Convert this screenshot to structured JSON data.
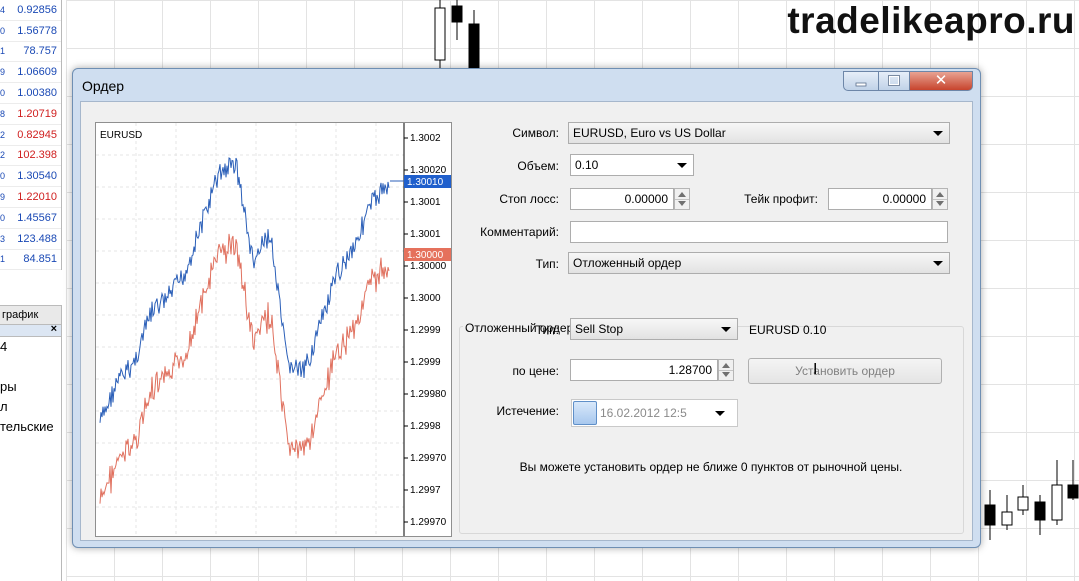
{
  "watermark": "tradelikeapro.ru",
  "quotes": [
    {
      "mark": "4",
      "value": "0.92856",
      "color": "up"
    },
    {
      "mark": "0",
      "value": "1.56778",
      "color": "up"
    },
    {
      "mark": "1",
      "value": "78.757",
      "color": "up"
    },
    {
      "mark": "9",
      "value": "1.06609",
      "color": "up"
    },
    {
      "mark": "0",
      "value": "1.00380",
      "color": "up"
    },
    {
      "mark": "8",
      "value": "1.20719",
      "color": "down"
    },
    {
      "mark": "2",
      "value": "0.82945",
      "color": "down"
    },
    {
      "mark": "2",
      "value": "102.398",
      "color": "down"
    },
    {
      "mark": "0",
      "value": "1.30540",
      "color": "up"
    },
    {
      "mark": "9",
      "value": "1.22010",
      "color": "down"
    },
    {
      "mark": "0",
      "value": "1.45567",
      "color": "up"
    },
    {
      "mark": "3",
      "value": "123.488",
      "color": "up"
    },
    {
      "mark": "1",
      "value": "84.851",
      "color": "up"
    }
  ],
  "left_panel": {
    "tab_label": "график",
    "nav_close": "×",
    "items": [
      "4",
      "",
      "ры",
      "л",
      "тельские"
    ]
  },
  "dialog": {
    "title": "Ордер",
    "close_glyph": "✕",
    "chart": {
      "symbol_label": "EURUSD",
      "y_ticks": [
        "1.3002",
        "1.30020",
        "1.3001",
        "1.3001",
        "1.30000",
        "1.3000",
        "1.2999",
        "1.2999",
        "1.29980",
        "1.2998",
        "1.29970",
        "1.2997",
        "1.29970"
      ],
      "ask_price": "1.30010",
      "bid_price": "1.30000"
    },
    "form": {
      "symbol_label": "Символ:",
      "symbol_value": "EURUSD, Euro vs US Dollar",
      "volume_label": "Объем:",
      "volume_value": "0.10",
      "stoploss_label": "Стоп лосс:",
      "stoploss_value": "0.00000",
      "takeprofit_label": "Тейк профит:",
      "takeprofit_value": "0.00000",
      "comment_label": "Комментарий:",
      "comment_value": "",
      "type_label": "Тип:",
      "type_value": "Отложенный ордер"
    },
    "pending": {
      "group_title": "Отложенный ордер",
      "type_label": "Тип:",
      "type_value": "Sell Stop",
      "symbol_volume": "EURUSD 0.10",
      "price_label": "по цене:",
      "price_value": "1.28700",
      "place_button": "Установить ордер",
      "expiry_label": "Истечение:",
      "expiry_value": "16.02.2012 12:5",
      "info_text": "Вы можете установить ордер не ближе 0 пунктов от рыночной цены."
    }
  }
}
